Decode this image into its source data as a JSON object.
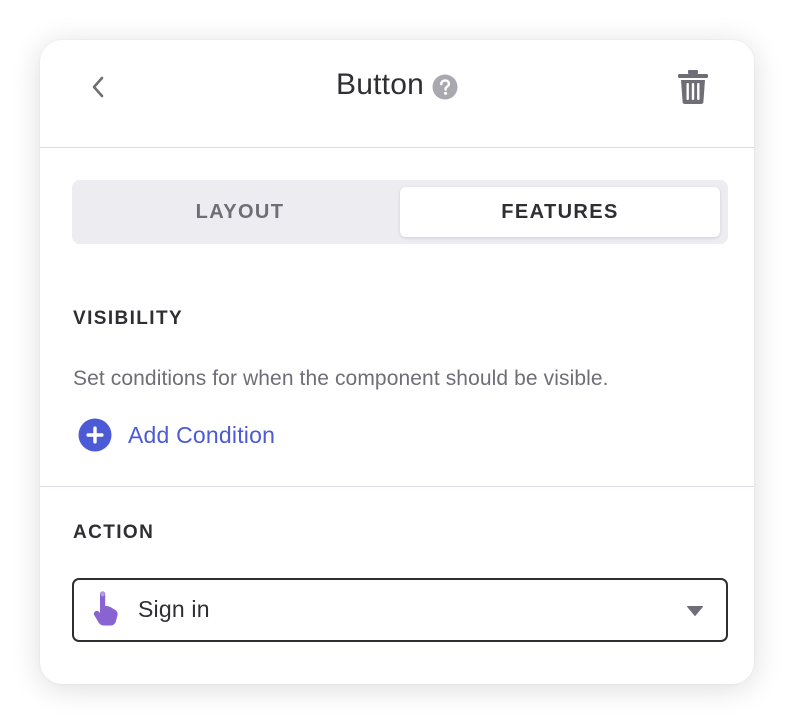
{
  "header": {
    "title": "Button",
    "back_icon": "chevron-left-icon",
    "help_icon": "question-mark-circle-icon",
    "delete_icon": "trash-icon"
  },
  "tabs": [
    {
      "label": "LAYOUT",
      "active": false
    },
    {
      "label": "FEATURES",
      "active": true
    }
  ],
  "visibility": {
    "heading": "VISIBILITY",
    "description": "Set conditions for when the component should be visible.",
    "add_condition_label": "Add Condition",
    "add_icon": "plus-circle-icon"
  },
  "action": {
    "heading": "ACTION",
    "selected_value": "Sign in",
    "value_icon": "tap-hand-icon",
    "caret_icon": "caret-down-icon"
  },
  "colors": {
    "accent": "#4c5ad6",
    "text_primary": "#2e2e33",
    "text_secondary": "#6f6e77",
    "tap_icon": "#8a63d2"
  }
}
